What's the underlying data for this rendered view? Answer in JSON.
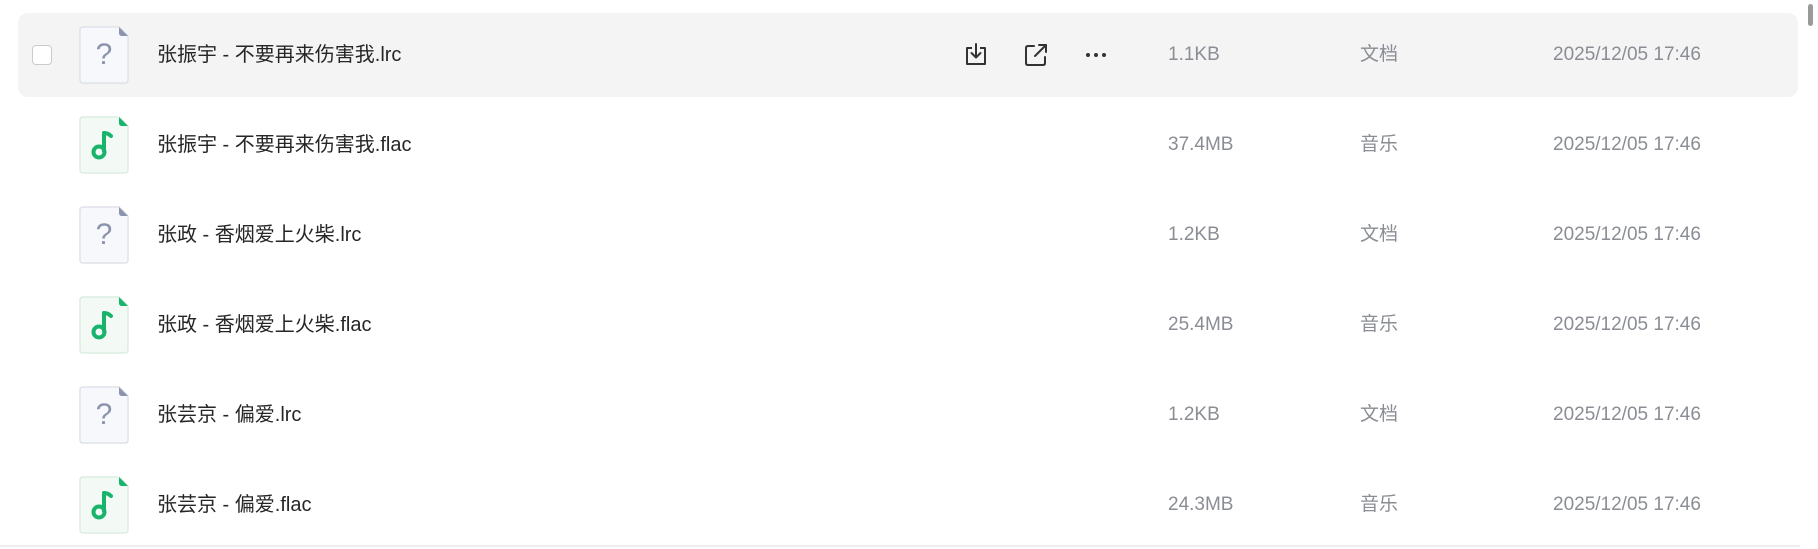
{
  "files": [
    {
      "name": "张振宇 - 不要再来伤害我.lrc",
      "size": "1.1KB",
      "type": "文档",
      "modified": "2025/12/05 17:46",
      "icon": "unknown-file-icon",
      "hovered": true
    },
    {
      "name": "张振宇 - 不要再来伤害我.flac",
      "size": "37.4MB",
      "type": "音乐",
      "modified": "2025/12/05 17:46",
      "icon": "music-file-icon",
      "hovered": false
    },
    {
      "name": "张政 - 香烟爱上火柴.lrc",
      "size": "1.2KB",
      "type": "文档",
      "modified": "2025/12/05 17:46",
      "icon": "unknown-file-icon",
      "hovered": false
    },
    {
      "name": "张政 - 香烟爱上火柴.flac",
      "size": "25.4MB",
      "type": "音乐",
      "modified": "2025/12/05 17:46",
      "icon": "music-file-icon",
      "hovered": false
    },
    {
      "name": "张芸京 - 偏爱.lrc",
      "size": "1.2KB",
      "type": "文档",
      "modified": "2025/12/05 17:46",
      "icon": "unknown-file-icon",
      "hovered": false
    },
    {
      "name": "张芸京 - 偏爱.flac",
      "size": "24.3MB",
      "type": "音乐",
      "modified": "2025/12/05 17:46",
      "icon": "music-file-icon",
      "hovered": false
    }
  ],
  "row_actions": {
    "download_icon": "download-icon",
    "share_icon": "share-icon",
    "more_icon": "more-icon"
  },
  "colors": {
    "hover_row": "#f4f4f5",
    "music_accent": "#19b46b",
    "unknown_accent": "#8c93ad"
  }
}
